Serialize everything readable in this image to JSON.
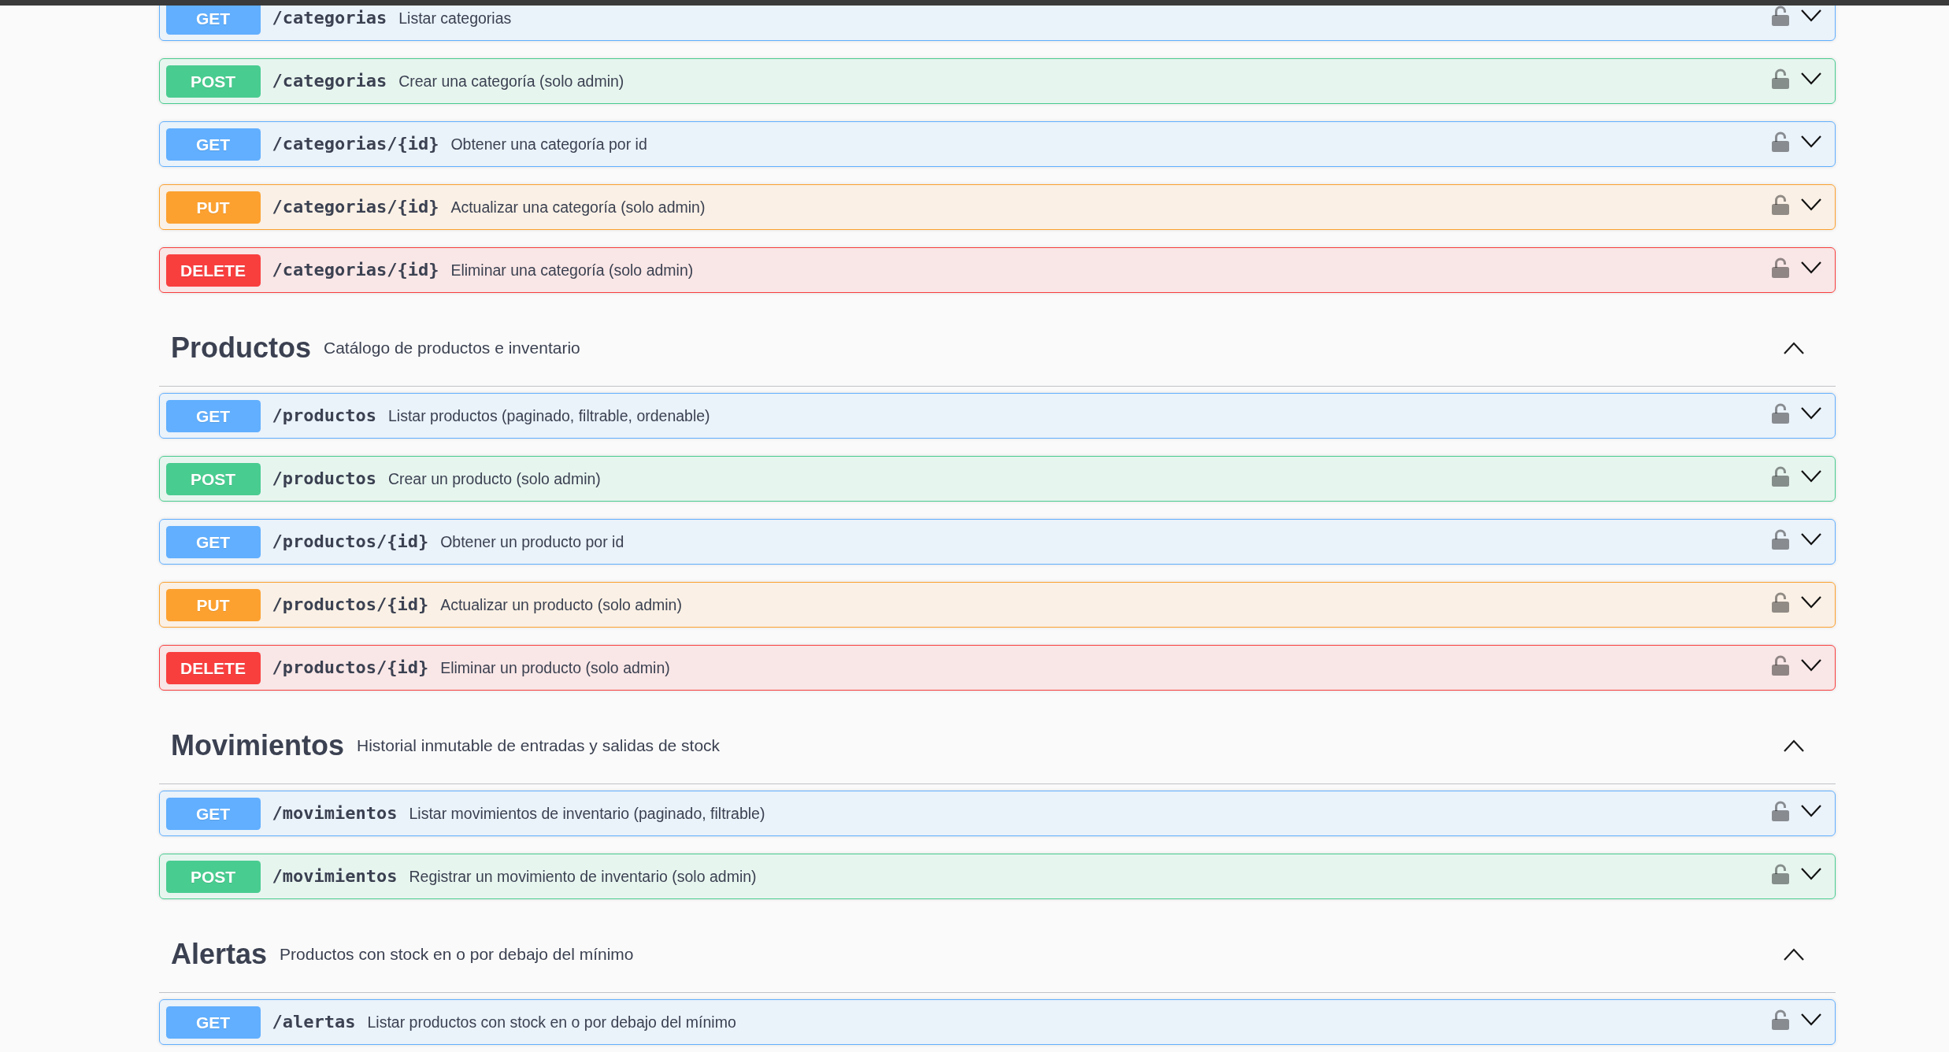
{
  "sections": [
    {
      "operations": [
        {
          "method": "GET",
          "color": "#61affe",
          "path": "/categorias",
          "summary": "Listar categorias",
          "locked": false,
          "expanded": false
        },
        {
          "method": "POST",
          "color": "#49cc90",
          "path": "/categorias",
          "summary": "Crear una categoría (solo admin)",
          "locked": false,
          "expanded": false
        },
        {
          "method": "GET",
          "color": "#61affe",
          "path": "/categorias/{id}",
          "summary": "Obtener una categoría por id",
          "locked": false,
          "expanded": false
        },
        {
          "method": "PUT",
          "color": "#fca130",
          "path": "/categorias/{id}",
          "summary": "Actualizar una categoría (solo admin)",
          "locked": false,
          "expanded": false
        },
        {
          "method": "DELETE",
          "color": "#f93e3e",
          "path": "/categorias/{id}",
          "summary": "Eliminar una categoría (solo admin)",
          "locked": false,
          "expanded": false
        }
      ]
    },
    {
      "name": "Productos",
      "description": "Catálogo de productos e inventario",
      "expanded": true,
      "operations": [
        {
          "method": "GET",
          "color": "#61affe",
          "path": "/productos",
          "summary": "Listar productos (paginado, filtrable, ordenable)",
          "locked": false,
          "expanded": false
        },
        {
          "method": "POST",
          "color": "#49cc90",
          "path": "/productos",
          "summary": "Crear un producto (solo admin)",
          "locked": false,
          "expanded": false
        },
        {
          "method": "GET",
          "color": "#61affe",
          "path": "/productos/{id}",
          "summary": "Obtener un producto por id",
          "locked": false,
          "expanded": false
        },
        {
          "method": "PUT",
          "color": "#fca130",
          "path": "/productos/{id}",
          "summary": "Actualizar un producto (solo admin)",
          "locked": false,
          "expanded": false
        },
        {
          "method": "DELETE",
          "color": "#f93e3e",
          "path": "/productos/{id}",
          "summary": "Eliminar un producto (solo admin)",
          "locked": false,
          "expanded": false
        }
      ]
    },
    {
      "name": "Movimientos",
      "description": "Historial inmutable de entradas y salidas de stock",
      "expanded": true,
      "operations": [
        {
          "method": "GET",
          "color": "#61affe",
          "path": "/movimientos",
          "summary": "Listar movimientos de inventario (paginado, filtrable)",
          "locked": false,
          "expanded": false
        },
        {
          "method": "POST",
          "color": "#49cc90",
          "path": "/movimientos",
          "summary": "Registrar un movimiento de inventario (solo admin)",
          "locked": false,
          "expanded": false
        }
      ]
    },
    {
      "name": "Alertas",
      "description": "Productos con stock en o por debajo del mínimo",
      "expanded": true,
      "operations": [
        {
          "method": "GET",
          "color": "#61affe",
          "path": "/alertas",
          "summary": "Listar productos con stock en o por debajo del mínimo",
          "locked": false,
          "expanded": false
        }
      ]
    }
  ]
}
